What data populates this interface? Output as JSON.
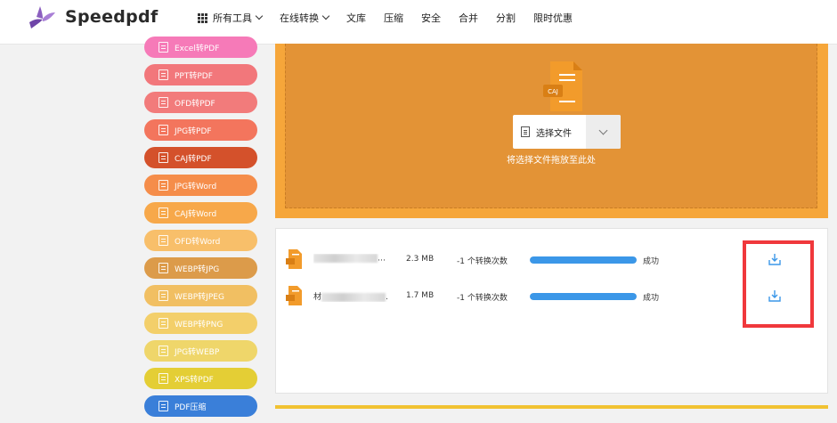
{
  "header": {
    "brand": "Speedpdf",
    "nav": [
      {
        "label": "所有工具",
        "dropdown": true,
        "grid": true
      },
      {
        "label": "在线转换",
        "dropdown": true
      },
      {
        "label": "文库"
      },
      {
        "label": "压缩"
      },
      {
        "label": "安全"
      },
      {
        "label": "合并"
      },
      {
        "label": "分割"
      },
      {
        "label": "限时优惠"
      }
    ]
  },
  "sidebar": {
    "items": [
      {
        "label": "Excel转PDF",
        "color": "#f67ab8"
      },
      {
        "label": "PPT转PDF",
        "color": "#f2777b"
      },
      {
        "label": "OFD转PDF",
        "color": "#f27b7b"
      },
      {
        "label": "JPG转PDF",
        "color": "#f3755d"
      },
      {
        "label": "CAJ转PDF",
        "color": "#d4512b"
      },
      {
        "label": "JPG转Word",
        "color": "#f58d4a"
      },
      {
        "label": "CAJ转Word",
        "color": "#f7a84a"
      },
      {
        "label": "OFD转Word",
        "color": "#f8bf6a"
      },
      {
        "label": "WEBP转JPG",
        "color": "#dc9b4a"
      },
      {
        "label": "WEBP转JPEG",
        "color": "#f1bf62"
      },
      {
        "label": "WEBP转PNG",
        "color": "#f3cf6a"
      },
      {
        "label": "JPG转WEBP",
        "color": "#efd66a"
      },
      {
        "label": "XPS转PDF",
        "color": "#e4ce35"
      },
      {
        "label": "PDF压缩",
        "color": "#3a7fd9"
      }
    ]
  },
  "upload": {
    "file_badge": "CAJ",
    "select_label": "选择文件",
    "drop_hint": "将选择文件拖放至此处"
  },
  "files": [
    {
      "name_prefix": "",
      "size": "2.3 MB",
      "count": "-1 个转换次数",
      "progress": 100,
      "status": "成功"
    },
    {
      "name_prefix": "材",
      "size": "1.7 MB",
      "count": "-1 个转换次数",
      "progress": 100,
      "status": "成功"
    }
  ],
  "colors": {
    "accent_orange": "#f6a63a",
    "progress_blue": "#3b97e8",
    "highlight_red": "#f0383c"
  }
}
